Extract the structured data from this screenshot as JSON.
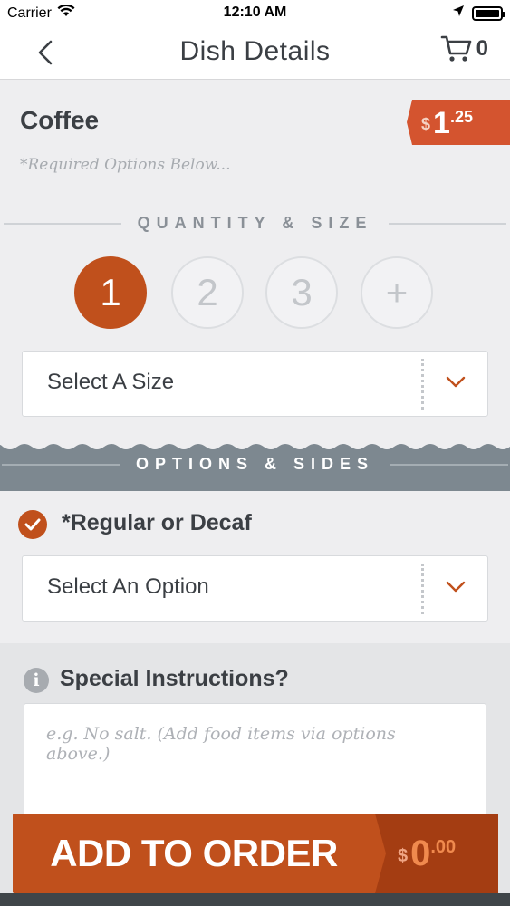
{
  "status_bar": {
    "carrier": "Carrier",
    "time": "12:10 AM"
  },
  "nav": {
    "title": "Dish Details",
    "cart_count": "0"
  },
  "dish": {
    "name": "Coffee",
    "required_note": "*Required Options Below...",
    "price": {
      "currency": "$",
      "whole": "1",
      "cents": ".25"
    }
  },
  "quantity": {
    "section_title": "QUANTITY & SIZE",
    "options": [
      "1",
      "2",
      "3",
      "+"
    ],
    "selected": "1",
    "size_select_label": "Select A Size"
  },
  "options_sides": {
    "section_title": "OPTIONS & SIDES",
    "option_label": "*Regular or Decaf",
    "option_select_label": "Select An Option"
  },
  "special": {
    "label": "Special Instructions?",
    "placeholder": "e.g. No salt. (Add food items via options above.)"
  },
  "order": {
    "button_label": "ADD TO ORDER",
    "total": {
      "currency": "$",
      "whole": "0",
      "cents": ".00"
    }
  },
  "colors": {
    "accent": "#c0501c",
    "band": "#7d8890",
    "text": "#3b3f44"
  }
}
